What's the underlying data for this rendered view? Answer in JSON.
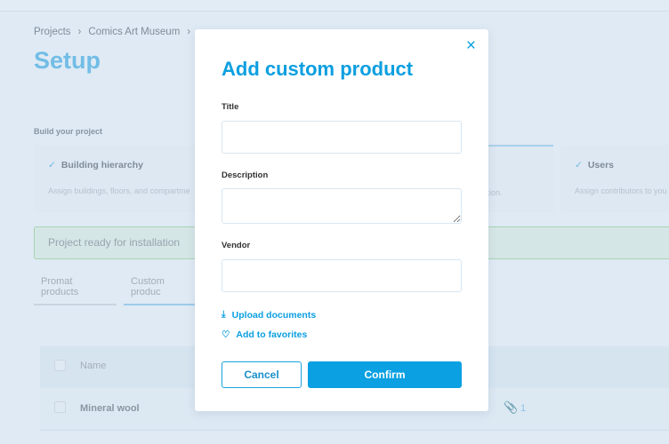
{
  "breadcrumb": [
    "Projects",
    "Comics Art Museum"
  ],
  "page_title": "Setup",
  "build_label": "Build your project",
  "steps": [
    {
      "title": "Building hierarchy",
      "desc": "Assign buildings, floors, and compartme"
    },
    {
      "title": "",
      "desc": "tration."
    },
    {
      "title": "Users",
      "desc": "Assign contributors to you"
    }
  ],
  "banner": "Project ready for installation",
  "tabs": [
    "Promat products",
    "Custom produc"
  ],
  "table": {
    "header_name": "Name",
    "rows": [
      {
        "name": "Mineral wool",
        "attachments": "1"
      }
    ]
  },
  "modal": {
    "title": "Add custom product",
    "fields": {
      "title": "Title",
      "description": "Description",
      "vendor": "Vendor"
    },
    "upload": "Upload documents",
    "favorites": "Add to favorites",
    "cancel": "Cancel",
    "confirm": "Confirm",
    "close_icon": "×"
  },
  "colors": {
    "accent": "#0ba0e2",
    "success_border": "#a9d3b2"
  }
}
